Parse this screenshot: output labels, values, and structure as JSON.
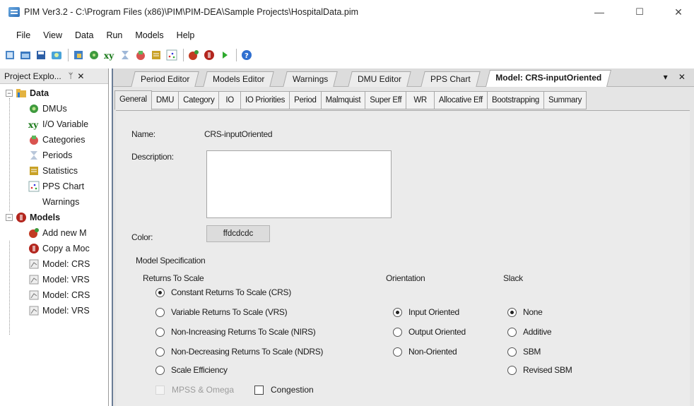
{
  "window": {
    "title": "PIM Ver3.2 - C:\\Program Files (x86)\\PIM\\PIM-DEA\\Sample Projects\\HospitalData.pim",
    "minimize": "—",
    "maximize": "☐",
    "close": "✕"
  },
  "menu": [
    "File",
    "View",
    "Data",
    "Run",
    "Models",
    "Help"
  ],
  "explorer": {
    "title": "Project Explo...",
    "pin": "ᛘ",
    "close": "✕",
    "data_group": "Data",
    "data_items": [
      "DMUs",
      "I/O Variable",
      "Categories",
      "Periods",
      "Statistics",
      "PPS Chart",
      "Warnings"
    ],
    "models_group": "Models",
    "model_items": [
      "Add new M",
      "Copy a Moc",
      "Model: CRS",
      "Model: VRS",
      "Model: CRS",
      "Model: VRS"
    ]
  },
  "doc_tabs": [
    "Period Editor",
    "Models Editor",
    "Warnings",
    "DMU Editor",
    "PPS Chart",
    "Model: CRS-inputOriented"
  ],
  "doc_tools": "▾ ✕",
  "sub_tabs": [
    "General",
    "DMU",
    "Category",
    "IO",
    "IO Priorities",
    "Period",
    "Malmquist",
    "Super Eff",
    "WR",
    "Allocative Eff",
    "Bootstrapping",
    "Summary"
  ],
  "general": {
    "name_label": "Name:",
    "name_value": "CRS-inputOriented",
    "description_label": "Description:",
    "description_value": "",
    "color_label": "Color:",
    "color_value": "ffdcdcdc",
    "model_spec_label": "Model Specification",
    "rts_label": "Returns To Scale",
    "rts_options": [
      {
        "label": "Constant Returns To Scale (CRS)",
        "selected": true
      },
      {
        "label": "Variable Returns To Scale (VRS)",
        "selected": false
      },
      {
        "label": "Non-Increasing Returns To Scale (NIRS)",
        "selected": false
      },
      {
        "label": "Non-Decreasing Returns To Scale (NDRS)",
        "selected": false
      },
      {
        "label": "Scale Efficiency",
        "selected": false
      }
    ],
    "orientation_label": "Orientation",
    "orientation_options": [
      {
        "label": "Input Oriented",
        "selected": true
      },
      {
        "label": "Output Oriented",
        "selected": false
      },
      {
        "label": "Non-Oriented",
        "selected": false
      }
    ],
    "slack_label": "Slack",
    "slack_options": [
      {
        "label": "None",
        "selected": true
      },
      {
        "label": "Additive",
        "selected": false
      },
      {
        "label": "SBM",
        "selected": false
      },
      {
        "label": "Revised SBM",
        "selected": false
      }
    ],
    "mpss_label": "MPSS & Omega",
    "congestion_label": "Congestion"
  }
}
